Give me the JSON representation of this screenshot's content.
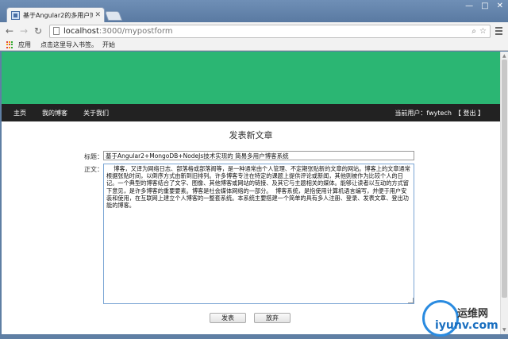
{
  "browser": {
    "tab_title": "基于Angular2的多用户博",
    "url_host": "localhost",
    "url_path": ":3000/mypostform",
    "bookmarks": {
      "apps_label": "应用",
      "import_hint": "点击这里导入书签。",
      "start_label": "开始"
    }
  },
  "site": {
    "colors": {
      "hero": "#2bb673",
      "navbar": "#222222"
    },
    "nav": {
      "home": "主页",
      "my_blog": "我的博客",
      "about": "关于我们"
    },
    "user": {
      "label": "当前用户：fwytech",
      "logout": "【 登出 】"
    }
  },
  "form": {
    "heading": "发表新文章",
    "title_label": "标题：",
    "title_value": "基于Angular2+MongoDB+NodeJs技术实现的 简易多用户博客系统",
    "body_label": "正文：",
    "body_value": "    博客，又译为网络日志、部落格或部落阁等，是一种通常由个人管理、不定期张贴新的文章的网站。博客上的文章通常根据张贴时间，以倒序方式由新到旧排列。许多博客专注在特定的课题上提供评论或新闻，其他则被作为比较个人的日记。一个典型的博客结合了文字、图像、其他博客或网站的链接、及其它与主题相关的媒体。能够让读者以互动的方式留下意见，是许多博客的重要要素。博客是社会媒体网络的一部分。  博客系统，是指使用计算机语言编写，并便于用户安装和使用，在互联网上建立个人博客的一整套系统。本系统主要搭建一个简单的具有多人注册、登录、发表文章、登出功能的博客。",
    "submit_label": "发表",
    "cancel_label": "放弃"
  },
  "watermark": {
    "cn": "运维网",
    "domain": "iyunv.com"
  }
}
